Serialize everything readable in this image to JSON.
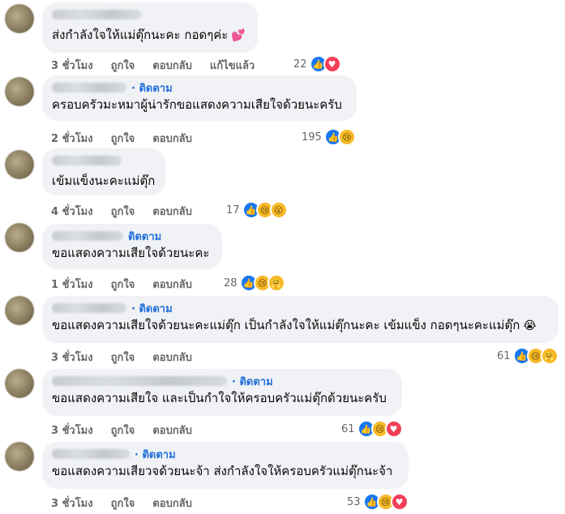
{
  "comments": [
    {
      "follow": "",
      "text": "ส่งกำลังใจให้แม่ตุ๊กนะคะ กอดๆค่ะ",
      "emoji": "💕",
      "time": "3 ชั่วโมง",
      "like_label": "ถูกใจ",
      "reply_label": "ตอบกลับ",
      "edited_label": "แก้ไขแล้ว",
      "count": "22",
      "reactions": [
        "like",
        "heart"
      ]
    },
    {
      "follow": "· ติดตาม",
      "text": "ครอบครัวมะหมาผู้น่ารักขอแสดงความเสียใจด้วยนะครับ",
      "time": "2 ชั่วโมง",
      "like_label": "ถูกใจ",
      "reply_label": "ตอบกลับ",
      "count": "195",
      "reactions": [
        "like",
        "sad"
      ]
    },
    {
      "follow": "",
      "text": "เข้มแข็งนะคะแม่ตุ๊ก",
      "time": "4 ชั่วโมง",
      "like_label": "ถูกใจ",
      "reply_label": "ตอบกลับ",
      "count": "17",
      "reactions": [
        "like",
        "sad",
        "wow"
      ]
    },
    {
      "follow": "ติดตาม",
      "text": "ขอแสดงความเสียใจด้วยนะคะ",
      "time": "1 ชั่วโมง",
      "like_label": "ถูกใจ",
      "reply_label": "ตอบกลับ",
      "count": "28",
      "reactions": [
        "like",
        "sad",
        "care"
      ]
    },
    {
      "follow": "· ติดตาม",
      "text": "ขอแสดงความเสียใจด้วยนะคะแม่ตุ๊ก เป็นกำลังใจให้แม่ตุ๊กนะคะ เข้มแข็ง กอดๆนะคะแม่ตุ๊ก",
      "emoji": "😭",
      "time": "3 ชั่วโมง",
      "like_label": "ถูกใจ",
      "reply_label": "ตอบกลับ",
      "count": "61",
      "reactions": [
        "like",
        "sad",
        "care"
      ]
    },
    {
      "follow": "· ติดตาม",
      "text": "ขอแสดงความเสียใจ และเป็นกำใจให้ครอบครัวแม่ตุ๊กด้วยนะครับ",
      "time": "3 ชั่วโมง",
      "like_label": "ถูกใจ",
      "reply_label": "ตอบกลับ",
      "count": "61",
      "reactions": [
        "like",
        "sad",
        "heart"
      ]
    },
    {
      "follow": "· ติดตาม",
      "text": "ขอแสดงความเสียวจด้วยนะจ้า ส่งกำลังใจให้ครอบครัวแม่ตุ๊กนะจ้า",
      "time": "3 ชั่วโมง",
      "like_label": "ถูกใจ",
      "reply_label": "ตอบกลับ",
      "count": "53",
      "reactions": [
        "like",
        "sad",
        "heart"
      ]
    }
  ],
  "reaction_glyphs": {
    "like": "👍",
    "heart": "♥",
    "sad": "😢",
    "wow": "😮",
    "care": "🤗"
  }
}
